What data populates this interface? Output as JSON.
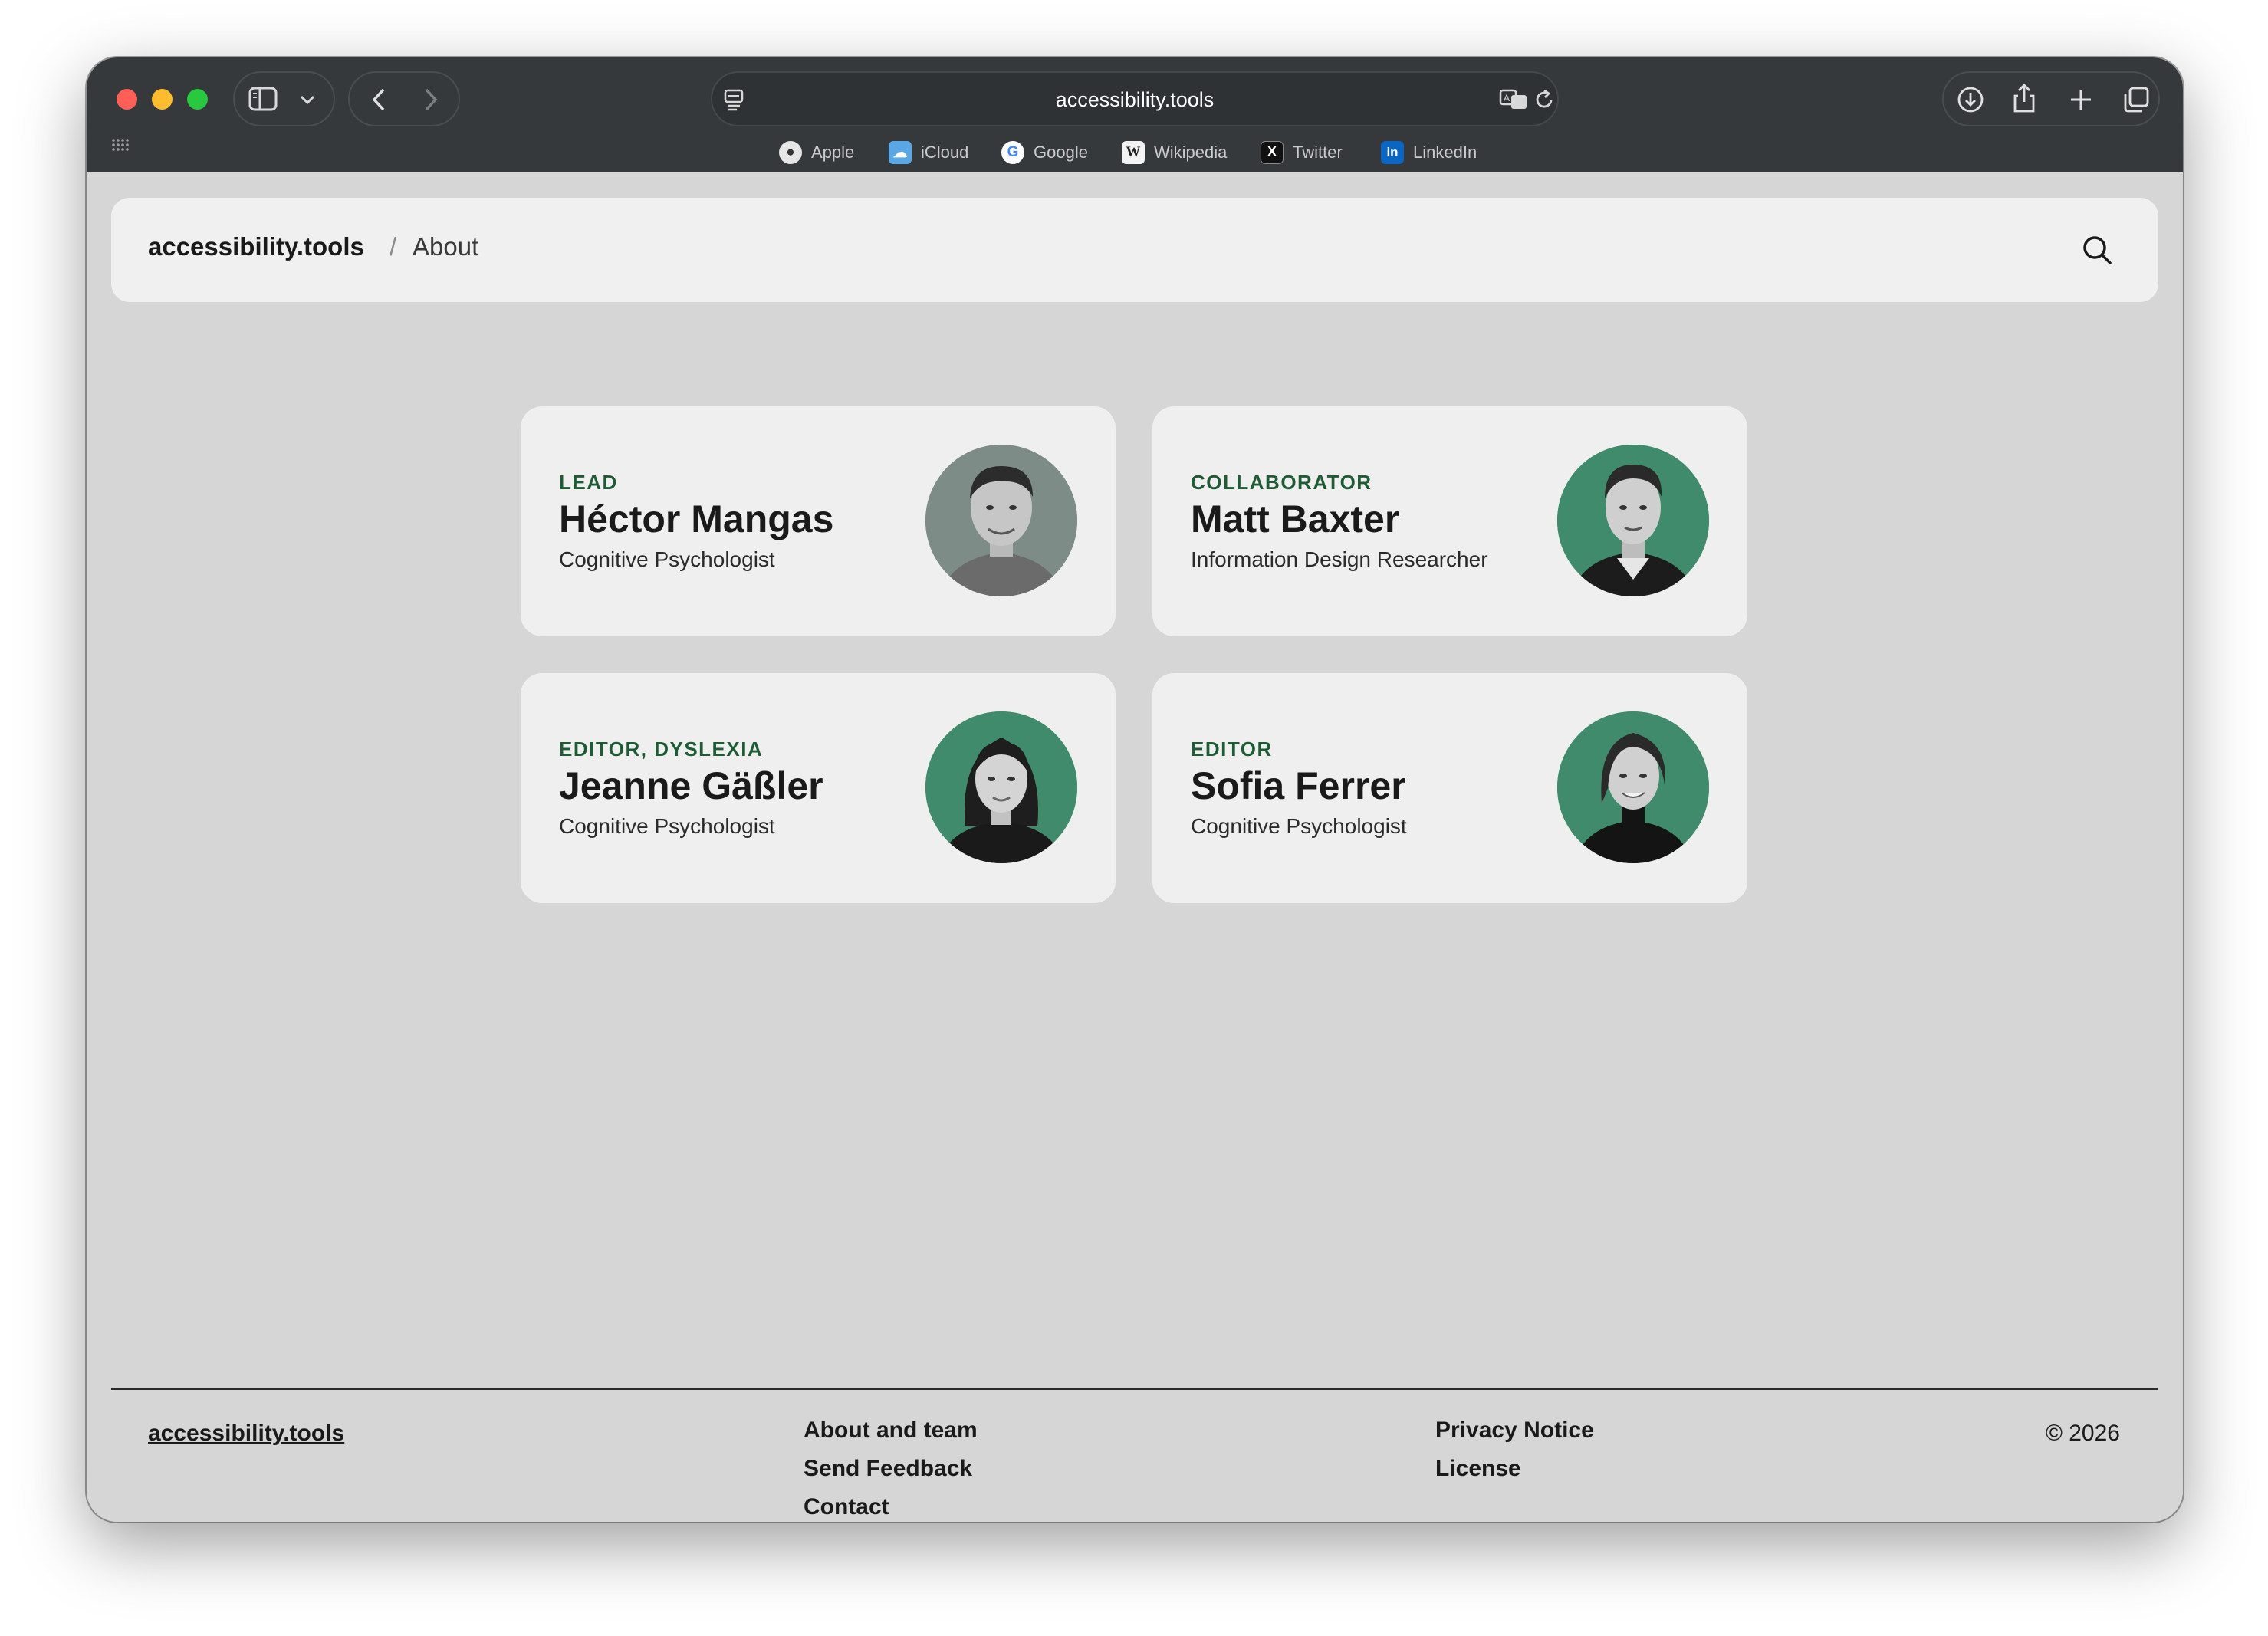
{
  "browser": {
    "url": "accessibility.tools",
    "favorites": [
      {
        "label": "Apple",
        "icon": "apple-icon"
      },
      {
        "label": "iCloud",
        "icon": "icloud-icon"
      },
      {
        "label": "Google",
        "icon": "google-icon"
      },
      {
        "label": "Wikipedia",
        "icon": "wikipedia-icon"
      },
      {
        "label": "Twitter",
        "icon": "twitter-icon"
      },
      {
        "label": "LinkedIn",
        "icon": "linkedin-icon"
      }
    ]
  },
  "header": {
    "brand": "accessibility.tools",
    "separator": "/",
    "current": "About"
  },
  "team": [
    {
      "role": "LEAD",
      "name": "Héctor Mangas",
      "title": "Cognitive Psychologist"
    },
    {
      "role": "COLLABORATOR",
      "name": "Matt Baxter",
      "title": "Information Design Researcher"
    },
    {
      "role": "EDITOR, DYSLEXIA",
      "name": "Jeanne Gäßler",
      "title": "Cognitive Psychologist"
    },
    {
      "role": "EDITOR",
      "name": "Sofia Ferrer",
      "title": "Cognitive Psychologist"
    }
  ],
  "footer": {
    "brand": "accessibility.tools",
    "col1": [
      "About and team",
      "Send Feedback",
      "Contact"
    ],
    "col2": [
      "Privacy Notice",
      "License"
    ],
    "copyright": "© 2026"
  },
  "colors": {
    "accent": "#1f5c35",
    "avatar_bg": "#3f8b6b",
    "page_bg": "#d6d6d6",
    "card_bg": "#efefef"
  }
}
